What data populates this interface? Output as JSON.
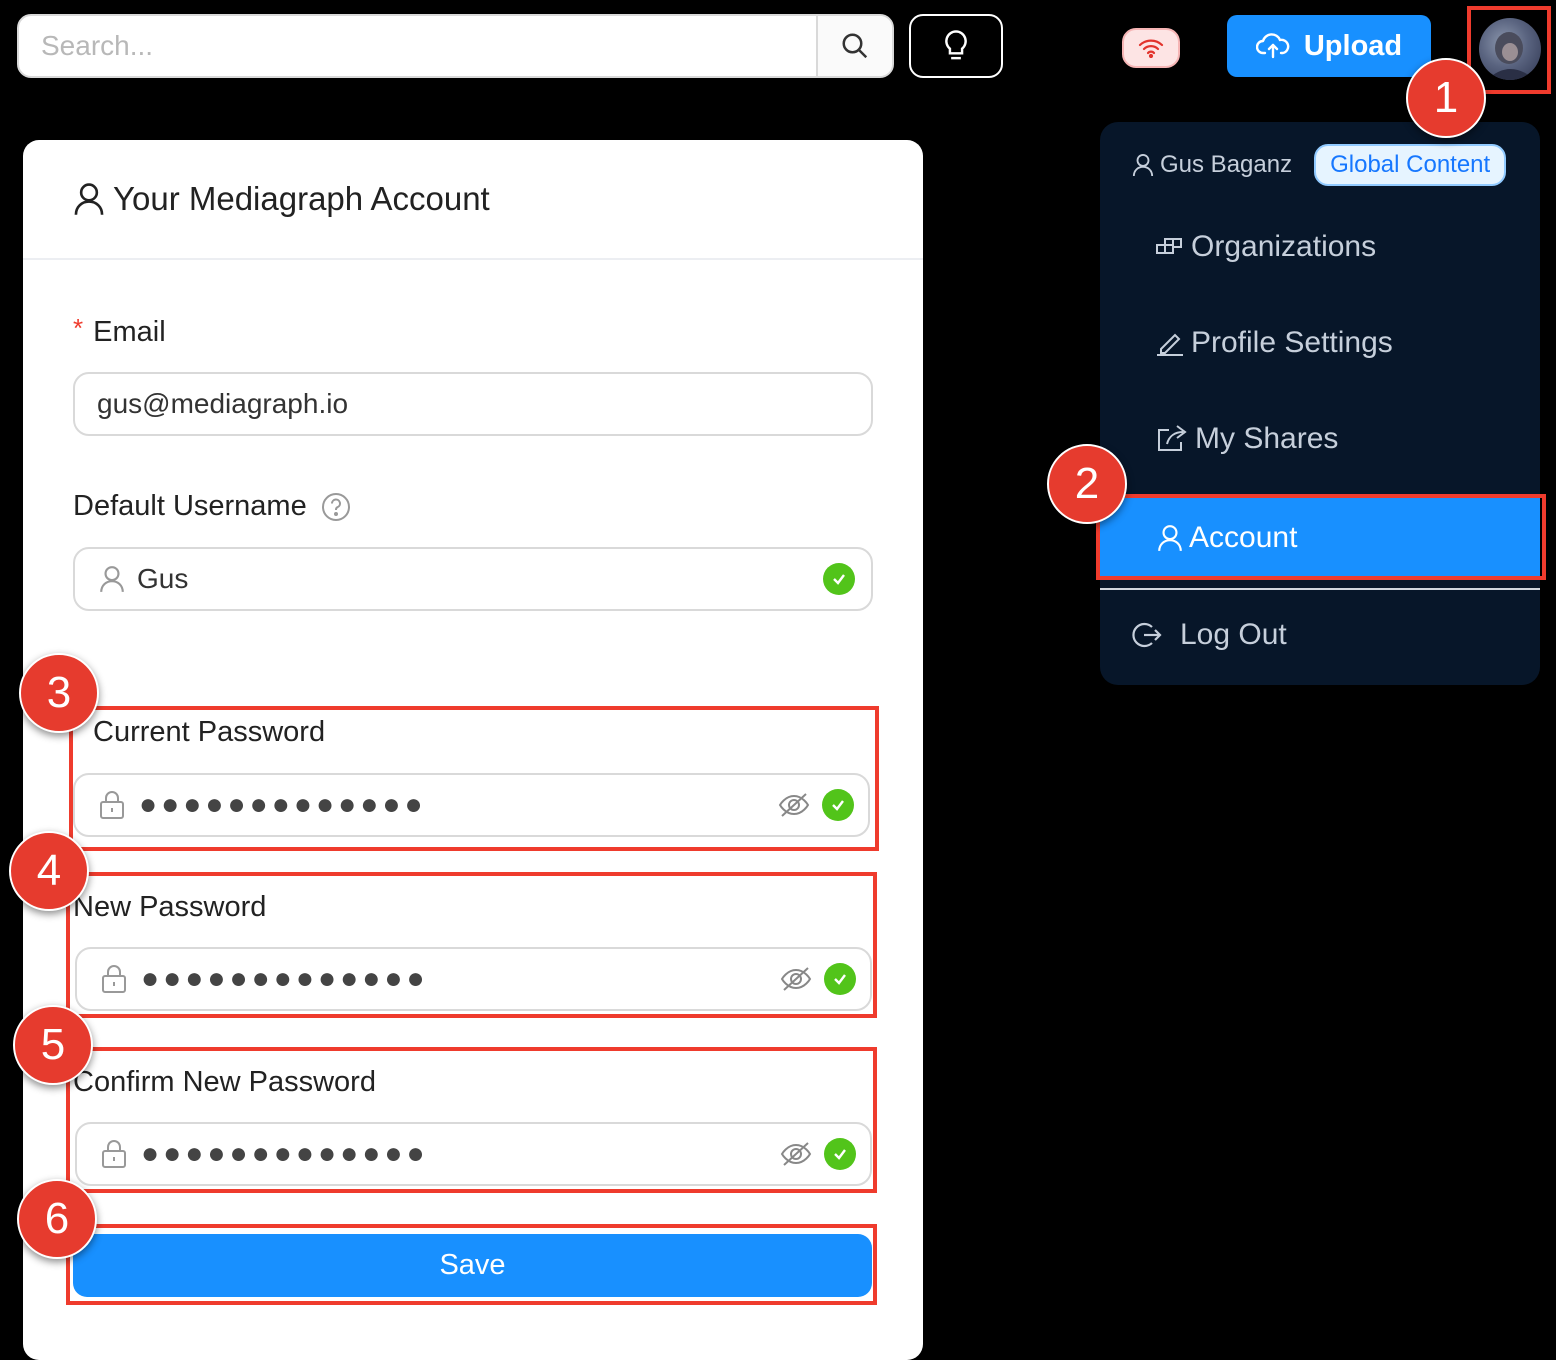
{
  "header": {
    "search_placeholder": "Search...",
    "upload_label": "Upload"
  },
  "card": {
    "title": "Your Mediagraph Account",
    "email_label": "Email",
    "email_required_mark": "*",
    "email_value": "gus@mediagraph.io",
    "username_label": "Default Username",
    "username_value": "Gus",
    "current_password_label": "Current Password",
    "current_password_mask": "●●●●●●●●●●●●●",
    "new_password_label": "New Password",
    "new_password_mask": "●●●●●●●●●●●●●",
    "confirm_password_label": "Confirm New Password",
    "confirm_password_mask": "●●●●●●●●●●●●●",
    "save_label": "Save"
  },
  "menu": {
    "user_name": "Gus Baganz",
    "badge": "Global Content",
    "items": {
      "organizations": "Organizations",
      "profile_settings": "Profile Settings",
      "my_shares": "My Shares",
      "account": "Account",
      "log_out": "Log Out"
    }
  },
  "annotations": {
    "step1": "1",
    "step2": "2",
    "step3": "3",
    "step4": "4",
    "step5": "5",
    "step6": "6"
  },
  "colors": {
    "primary": "#1890ff",
    "highlight": "#ef3b2d",
    "success": "#52c41a",
    "menu_bg": "#071629"
  }
}
